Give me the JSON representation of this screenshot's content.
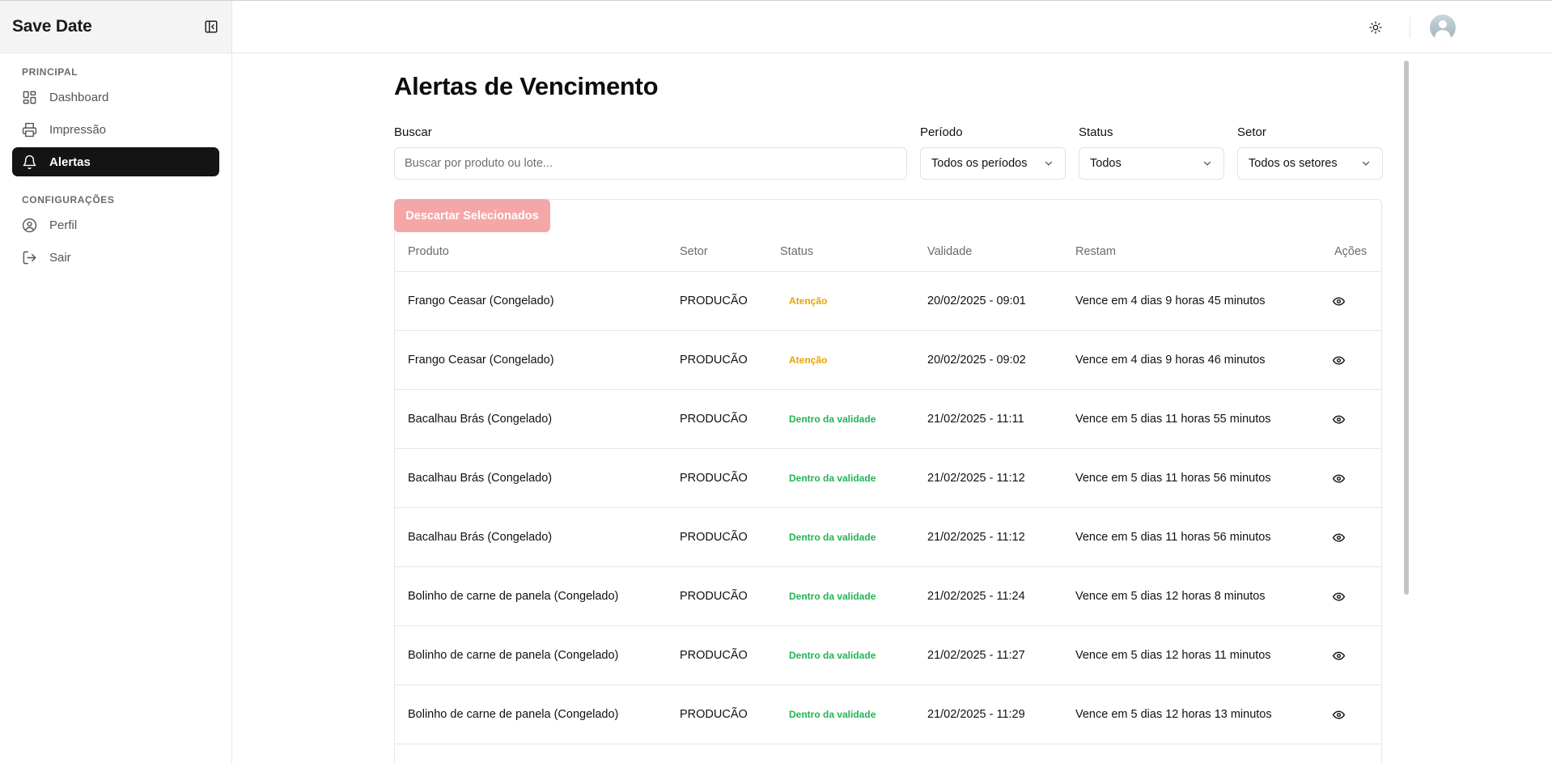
{
  "app": {
    "brand": "Save Date"
  },
  "sidebar": {
    "sections": [
      {
        "title": "PRINCIPAL",
        "items": [
          {
            "label": "Dashboard",
            "icon": "dashboard-icon",
            "active": false
          },
          {
            "label": "Impressão",
            "icon": "printer-icon",
            "active": false
          },
          {
            "label": "Alertas",
            "icon": "bell-icon",
            "active": true
          }
        ]
      },
      {
        "title": "CONFIGURAÇÕES",
        "items": [
          {
            "label": "Perfil",
            "icon": "user-circle-icon",
            "active": false
          },
          {
            "label": "Sair",
            "icon": "logout-icon",
            "active": false
          }
        ]
      }
    ]
  },
  "topbar": {
    "theme_icon": "sun-icon",
    "avatar_icon": "user-avatar-icon"
  },
  "page": {
    "title": "Alertas de Vencimento"
  },
  "filters": {
    "search": {
      "label": "Buscar",
      "placeholder": "Buscar por produto ou lote...",
      "value": ""
    },
    "period": {
      "label": "Período",
      "value": "Todos os períodos"
    },
    "status": {
      "label": "Status",
      "value": "Todos"
    },
    "sector": {
      "label": "Setor",
      "value": "Todos os setores"
    }
  },
  "actions": {
    "discard_label": "Descartar Selecionados"
  },
  "table": {
    "headers": {
      "product": "Produto",
      "sector": "Setor",
      "status": "Status",
      "validity": "Validade",
      "remaining": "Restam",
      "actions": "Ações"
    },
    "rows": [
      {
        "product": "Frango Ceasar (Congelado)",
        "sector": "PRODUCÃO",
        "status": "Atenção",
        "status_color": "#e8a300",
        "validity": "20/02/2025 - 09:01",
        "remaining": "Vence em 4 dias 9 horas 45 minutos"
      },
      {
        "product": "Frango Ceasar (Congelado)",
        "sector": "PRODUCÃO",
        "status": "Atenção",
        "status_color": "#e8a300",
        "validity": "20/02/2025 - 09:02",
        "remaining": "Vence em 4 dias 9 horas 46 minutos"
      },
      {
        "product": "Bacalhau Brás (Congelado)",
        "sector": "PRODUCÃO",
        "status": "Dentro da validade",
        "status_color": "#22b455",
        "validity": "21/02/2025 - 11:11",
        "remaining": "Vence em 5 dias 11 horas 55 minutos"
      },
      {
        "product": "Bacalhau Brás (Congelado)",
        "sector": "PRODUCÃO",
        "status": "Dentro da validade",
        "status_color": "#22b455",
        "validity": "21/02/2025 - 11:12",
        "remaining": "Vence em 5 dias 11 horas 56 minutos"
      },
      {
        "product": "Bacalhau Brás (Congelado)",
        "sector": "PRODUCÃO",
        "status": "Dentro da validade",
        "status_color": "#22b455",
        "validity": "21/02/2025 - 11:12",
        "remaining": "Vence em 5 dias 11 horas 56 minutos"
      },
      {
        "product": "Bolinho de carne de panela (Congelado)",
        "sector": "PRODUCÃO",
        "status": "Dentro da validade",
        "status_color": "#22b455",
        "validity": "21/02/2025 - 11:24",
        "remaining": "Vence em 5 dias 12 horas 8 minutos"
      },
      {
        "product": "Bolinho de carne de panela (Congelado)",
        "sector": "PRODUCÃO",
        "status": "Dentro da validade",
        "status_color": "#22b455",
        "validity": "21/02/2025 - 11:27",
        "remaining": "Vence em 5 dias 12 horas 11 minutos"
      },
      {
        "product": "Bolinho de carne de panela (Congelado)",
        "sector": "PRODUCÃO",
        "status": "Dentro da validade",
        "status_color": "#22b455",
        "validity": "21/02/2025 - 11:29",
        "remaining": "Vence em 5 dias 12 horas 13 minutos"
      }
    ]
  },
  "colors": {
    "active_nav_bg": "#141414",
    "discard_button_bg": "#f5a7a7",
    "warning": "#e8a300",
    "ok": "#22b455"
  }
}
